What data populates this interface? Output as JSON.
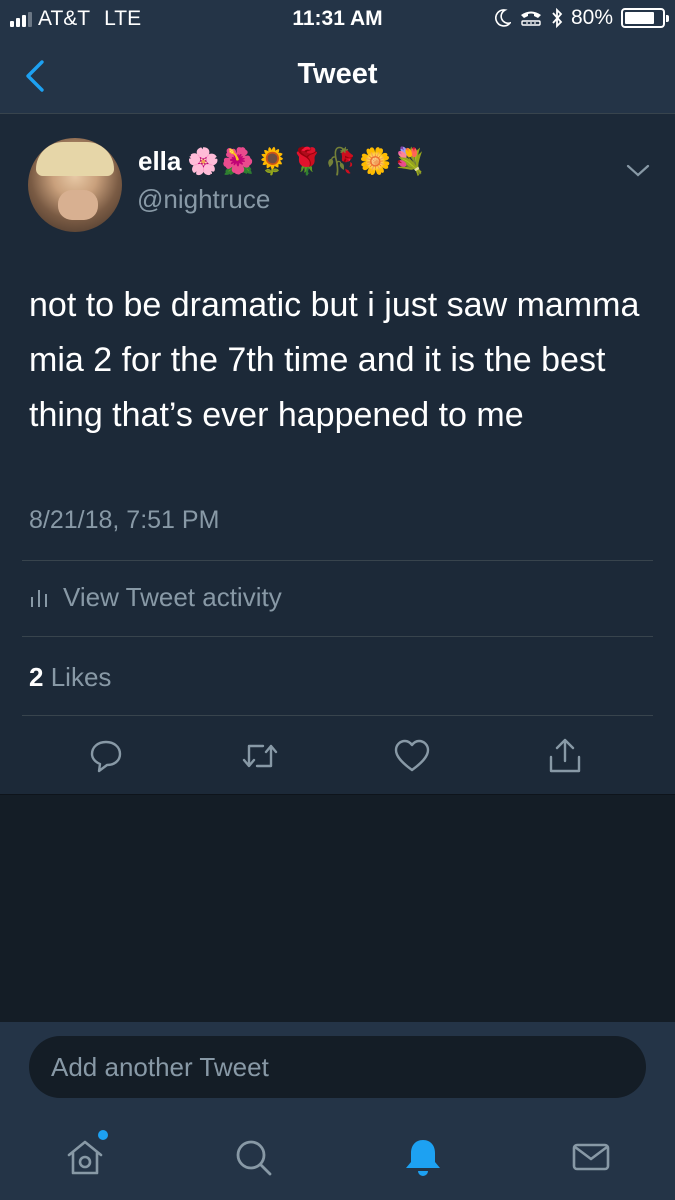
{
  "status_bar": {
    "carrier": "AT&T",
    "network": "LTE",
    "time": "11:31 AM",
    "battery_percent_label": "80%",
    "battery_level": 0.8,
    "signal_bars": 3,
    "icons": [
      "moon-icon",
      "tty-icon",
      "bluetooth-icon",
      "battery-icon"
    ]
  },
  "nav": {
    "title": "Tweet",
    "back_icon": "chevron-left-icon"
  },
  "tweet": {
    "author_name": "ella",
    "author_emojis": "🌸🌺🌻🌹🥀🌼💐",
    "author_handle": "@nightruce",
    "text": "not to be dramatic but i just saw mamma mia 2 for the 7th time and it is the best thing that’s ever happened to me",
    "timestamp": "8/21/18, 7:51 PM",
    "activity_label": "View Tweet activity",
    "likes_count": "2",
    "likes_label": "Likes",
    "action_icons": [
      "reply-icon",
      "retweet-icon",
      "like-icon",
      "share-icon"
    ]
  },
  "compose": {
    "placeholder": "Add another Tweet"
  },
  "tab_bar": {
    "tabs": [
      "home-icon",
      "search-icon",
      "notifications-icon",
      "messages-icon"
    ],
    "active": "notifications-icon"
  },
  "colors": {
    "background": "#141d26",
    "bar": "#243447",
    "card": "#1c2938",
    "secondary_text": "#8899a6",
    "accent": "#1da1f2",
    "divider": "#38444d"
  }
}
